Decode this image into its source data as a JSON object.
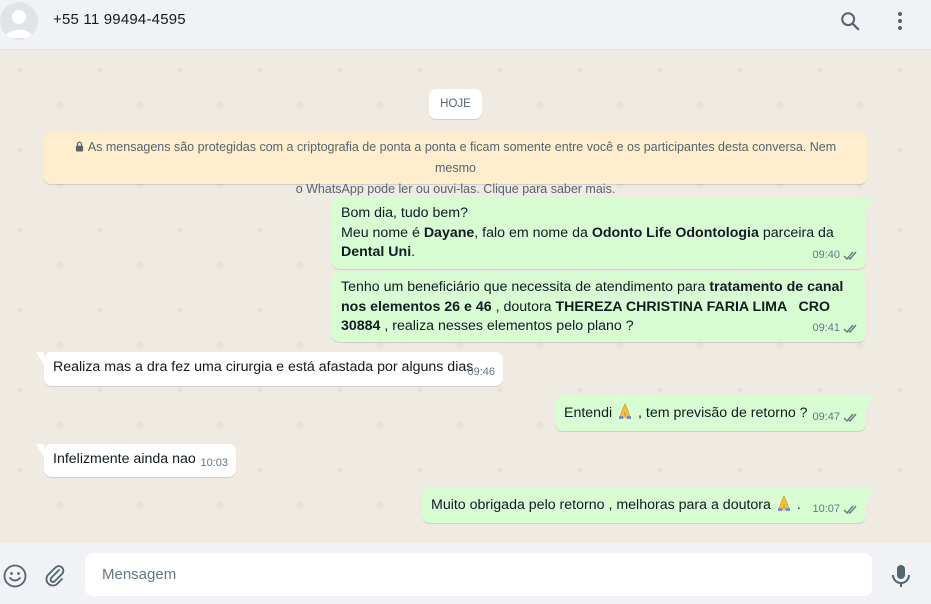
{
  "header": {
    "contact_name": "+55 11 99494-4595",
    "icons": {
      "avatar": "default-avatar",
      "search": "search-icon",
      "menu": "menu-dots-icon"
    }
  },
  "chat": {
    "date_label": "HOJE",
    "encryption_notice": {
      "line1": "As mensagens são protegidas com a criptografia de ponta a ponta e ficam somente entre você e os participantes desta conversa. Nem mesmo",
      "line2": "o WhatsApp pode ler ou ouvi-las. Clique para saber mais."
    },
    "messages": [
      {
        "direction": "out",
        "time": "09:40",
        "status": "read",
        "parts": {
          "l1": "Bom dia, tudo bem?",
          "l2a": "Meu nome é ",
          "l2b": "Dayane",
          "l2c": ", falo em nome da ",
          "l2d": "Odonto Life Odontologia",
          "l2e": " parceira da",
          "l3a": "Dental Uni",
          "l3b": "."
        }
      },
      {
        "direction": "out",
        "time": "09:41",
        "status": "read",
        "parts": {
          "a": "Tenho um beneficiário que necessita de atendimento para ",
          "b": "tratamento de canal nos elementos 26 e 46",
          "c": " , doutora ",
          "d": "THEREZA CHRISTINA FARIA LIMA   CRO 30884",
          "e": " , realiza nesses elementos pelo plano ?"
        }
      },
      {
        "direction": "in",
        "time": "09:46",
        "text": "Realiza mas a dra fez uma cirurgia e está afastada por alguns dias"
      },
      {
        "direction": "out",
        "time": "09:47",
        "status": "read",
        "parts": {
          "a": "Entendi ",
          "b": " , tem previsão de retorno ?"
        },
        "emoji": "folded-hands-emoji"
      },
      {
        "direction": "in",
        "time": "10:03",
        "text": "Infelizmente ainda nao"
      },
      {
        "direction": "out",
        "time": "10:07",
        "status": "read",
        "parts": {
          "a": "Muito obrigada pelo retorno , melhoras para a doutora ",
          "b": " ."
        },
        "emoji": "folded-hands-emoji"
      }
    ]
  },
  "composer": {
    "placeholder": "Mensagem",
    "value": "",
    "icons": {
      "emoji": "smiley-icon",
      "attach": "paperclip-icon",
      "mic": "microphone-icon"
    }
  },
  "colors": {
    "outgoing_bubble": "#d9fdd3",
    "incoming_bubble": "#ffffff",
    "chat_background": "#efeae2",
    "encryption_banner": "#ffeecd",
    "read_ticks": "#667781"
  }
}
